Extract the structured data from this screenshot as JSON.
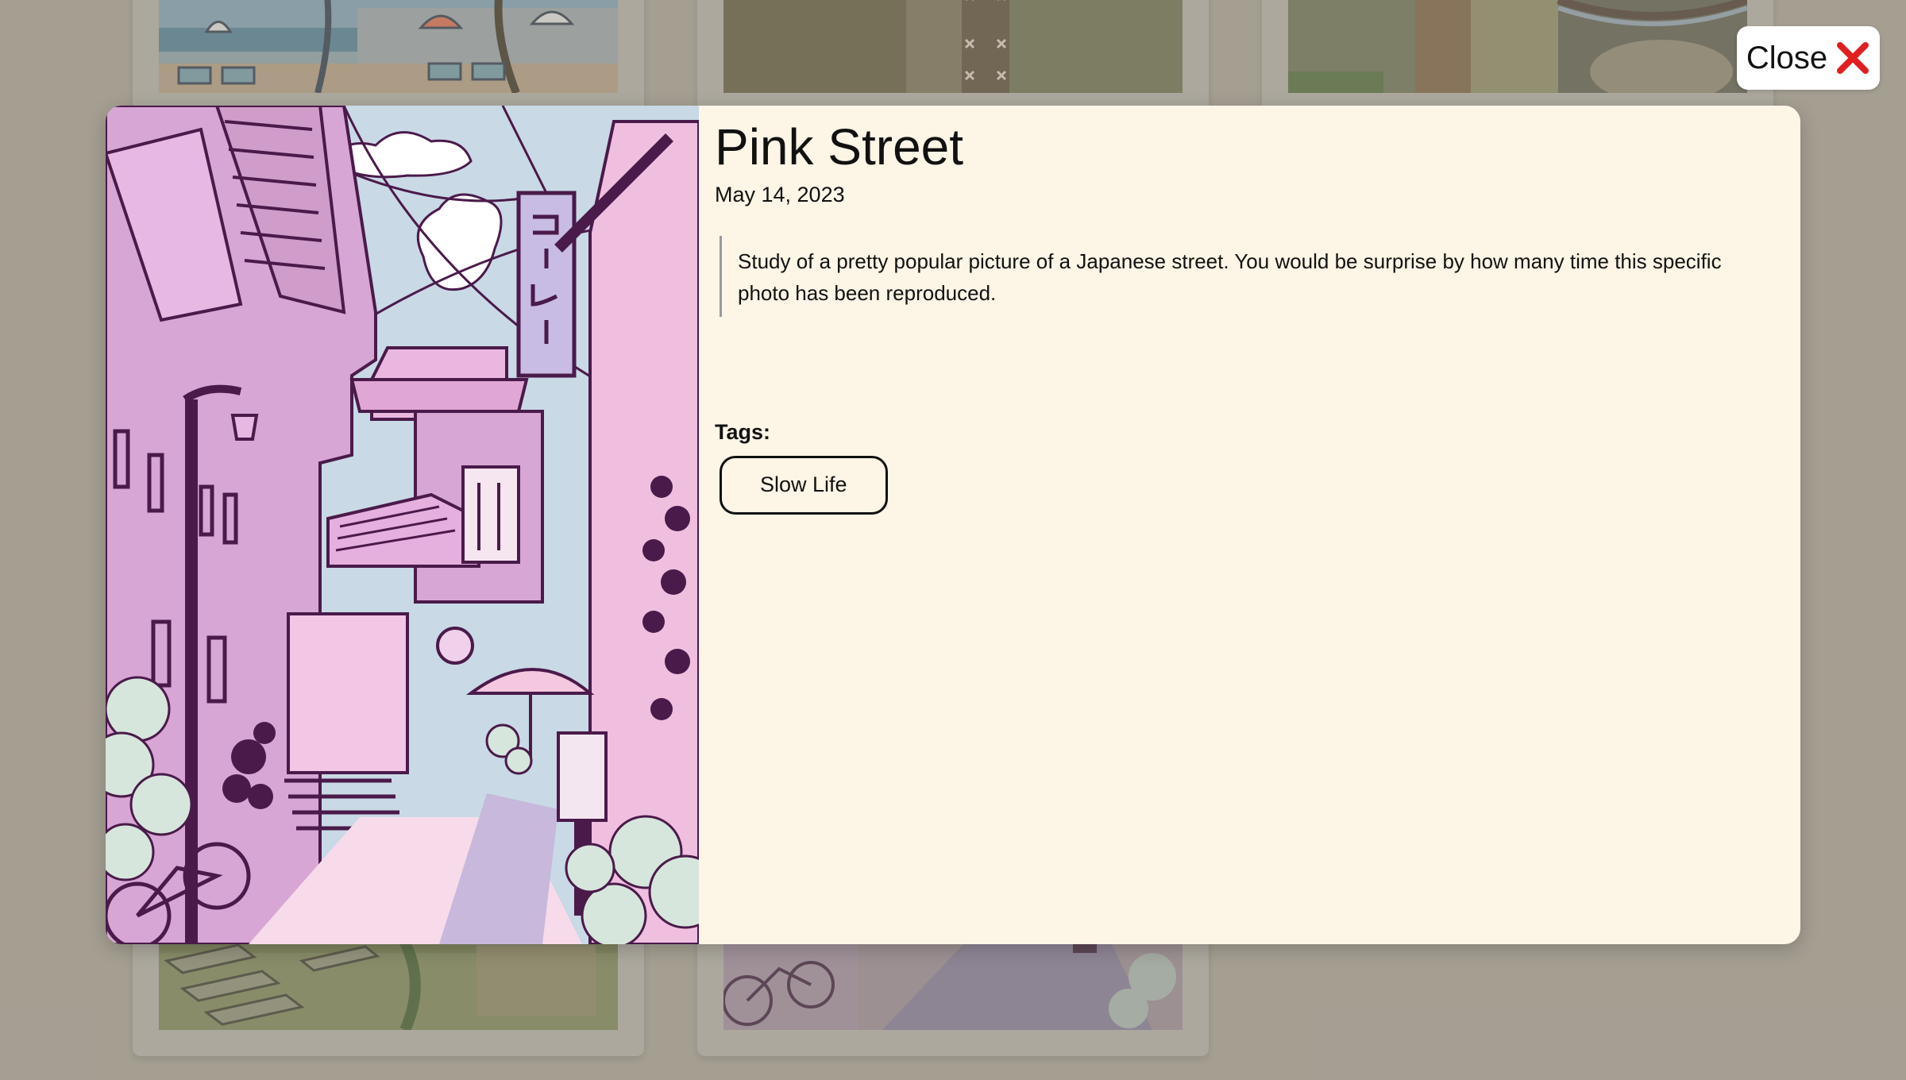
{
  "close_button": {
    "label": "Close",
    "icon": "close-x-icon",
    "icon_color": "#e02020"
  },
  "modal": {
    "image_alt": "Illustration of a pink Japanese street with shops, signs, plants and bicycles",
    "title": "Pink Street",
    "date": "May 14, 2023",
    "description": "Study of a pretty popular picture of a Japanese street. You would be surprise by how many time this specific photo has been reproduced.",
    "tags_label": "Tags:",
    "tags": [
      "Slow Life"
    ]
  },
  "colors": {
    "modal_background": "#fdf5e6",
    "page_background": "#a8a296"
  }
}
